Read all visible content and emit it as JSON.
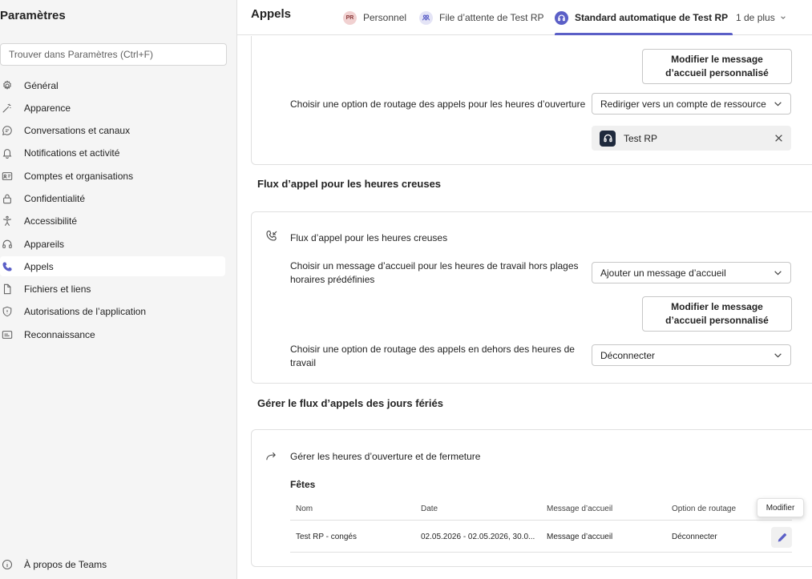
{
  "sidebar": {
    "title": "Paramètres",
    "search_placeholder": "Trouver dans Paramètres (Ctrl+F)",
    "items": [
      {
        "label": "Général",
        "icon": "gear-icon"
      },
      {
        "label": "Apparence",
        "icon": "wand-icon"
      },
      {
        "label": "Conversations et canaux",
        "icon": "chat-icon"
      },
      {
        "label": "Notifications et activité",
        "icon": "bell-icon"
      },
      {
        "label": "Comptes et organisations",
        "icon": "id-card-icon"
      },
      {
        "label": "Confidentialité",
        "icon": "lock-icon"
      },
      {
        "label": "Accessibilité",
        "icon": "accessibility-icon"
      },
      {
        "label": "Appareils",
        "icon": "headset-icon"
      },
      {
        "label": "Appels",
        "icon": "phone-icon",
        "active": true
      },
      {
        "label": "Fichiers et liens",
        "icon": "file-icon"
      },
      {
        "label": "Autorisations de l’application",
        "icon": "shield-icon"
      },
      {
        "label": "Reconnaissance",
        "icon": "caption-icon"
      }
    ],
    "about": "À propos de Teams"
  },
  "header": {
    "title": "Appels",
    "tabs": [
      {
        "label": "Personnel",
        "badge": "PR"
      },
      {
        "label": "File d’attente de Test RP"
      },
      {
        "label": "Standard automatique de Test RP",
        "active": true
      },
      {
        "label": "1 de plus"
      }
    ]
  },
  "business_hours": {
    "edit_greeting_button": "Modifier le message d’accueil personnalisé",
    "routing_label": "Choisir une option de routage des appels pour les heures d’ouverture",
    "routing_value": "Rediriger vers un compte de ressource",
    "resource_name": "Test RP"
  },
  "after_hours": {
    "heading": "Flux d’appel pour les heures creuses",
    "card_title": "Flux d’appel pour les heures creuses",
    "greeting_label": "Choisir un message d’accueil pour les heures de travail hors plages horaires prédéfinies",
    "greeting_value": "Ajouter un message d’accueil",
    "edit_greeting_button": "Modifier le message d’accueil personnalisé",
    "routing_label": "Choisir une option de routage des appels en dehors des heures de travail",
    "routing_value": "Déconnecter"
  },
  "holidays": {
    "heading": "Gérer le flux d’appels des jours fériés",
    "card_title": "Gérer les heures d’ouverture et de fermeture",
    "table_title": "Fêtes",
    "columns": [
      "Nom",
      "Date",
      "Message d’accueil",
      "Option de routage"
    ],
    "rows": [
      {
        "name": "Test RP - congés",
        "date": "02.05.2026 - 02.05.2026, 30.0...",
        "greeting": "Message d’accueil",
        "routing": "Déconnecter"
      }
    ],
    "edit_tooltip": "Modifier"
  },
  "colors": {
    "accent": "#5b5fc7",
    "sidebar_bg": "#f5f5f5"
  }
}
